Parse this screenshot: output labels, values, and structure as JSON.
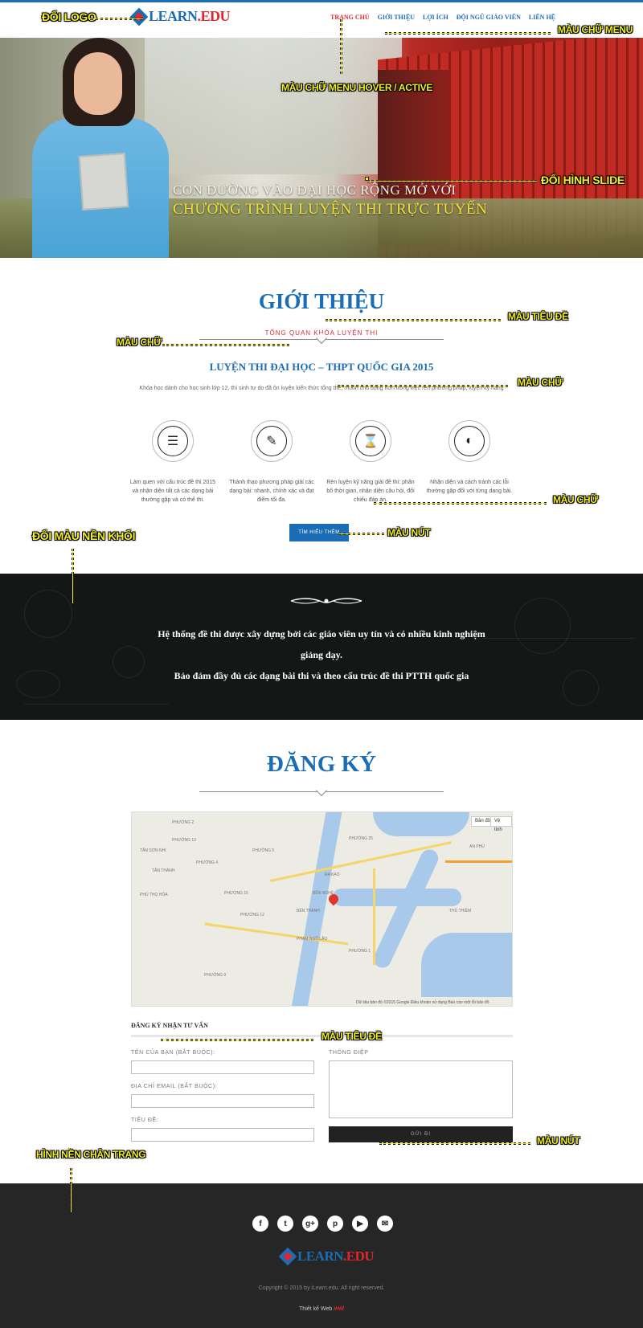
{
  "header": {
    "logo_main": "LEARN",
    "logo_ext": ".EDU",
    "menu": [
      {
        "label": "TRANG CHỦ",
        "active": true
      },
      {
        "label": "GIỚI THIỆU",
        "active": false
      },
      {
        "label": "LỢI ÍCH",
        "active": false
      },
      {
        "label": "ĐỘI NGŨ GIÁO VIÊN",
        "active": false
      },
      {
        "label": "LIÊN HỆ",
        "active": false
      }
    ]
  },
  "hero": {
    "line1": "CON ĐƯỜNG VÀO ĐẠI HỌC RỘNG MỞ VỚI",
    "line2": "CHƯƠNG TRÌNH LUYỆN THI TRỰC TUYẾN"
  },
  "intro": {
    "title": "GIỚI THIỆU",
    "subtitle": "TỔNG QUAN KHÓA LUYỆN THI",
    "course_title": "LUYỆN THI ĐẠI HỌC – THPT QUỐC GIA 2015",
    "course_desc": "Khóa học dành cho học sinh lớp 12, thí sinh tự do đã ôn luyện kiến thức tổng thể, muốn chủ động hơn trong việc rèn phương pháp, luyện kỹ năng",
    "features": [
      {
        "icon": "list-icon",
        "glyph": "☰",
        "text": "Làm quen với cấu trúc đề thi 2015 và nhận diện tất cả các dạng bài thường gặp và có thể thi."
      },
      {
        "icon": "pencil-icon",
        "glyph": "✎",
        "text": "Thành thạo phương pháp giải các dạng bài: nhanh, chính xác và đạt điểm tối đa."
      },
      {
        "icon": "hourglass-icon",
        "glyph": "⌛",
        "text": "Rèn luyện kỹ năng giải đề thi: phân bổ thời gian, nhận diện câu hỏi, đối chiếu đáp án."
      },
      {
        "icon": "brightness-icon",
        "glyph": "◐",
        "text": "Nhận diện và cách tránh các lỗi thường gặp đối với từng dạng bài."
      }
    ],
    "button": "TÌM HIỂU THÊM"
  },
  "band": {
    "line1": "Hệ thống đề thi được xây dựng bởi các giáo viên uy tín và có nhiều kinh nghiệm",
    "line2": "giảng dạy.",
    "line3": "Bảo đảm đầy đủ các dạng bài thi và theo cấu trúc đề thi PTTH quốc gia"
  },
  "register": {
    "title": "ĐĂNG KÝ",
    "map_btn_map": "Bản đồ",
    "map_btn_sat": "Vệ tinh",
    "map_footer": "Dữ liệu bản đồ ©2015 Google   Điều khoản sử dụng   Báo cáo một lỗi bản đồ",
    "map_labels": [
      "PHƯỜNG 2",
      "PHƯỜNG 13",
      "TÂN SƠN NHÌ",
      "TÂN THÀNH",
      "PHƯỜNG 4",
      "PHƯỜNG 25",
      "PHƯỜNG 5",
      "PHÚ THỌ HÒA",
      "PHƯỜNG 15",
      "ĐA KAO",
      "BẾN NGHÉ",
      "BẾN THÀNH",
      "PHẠM NGŨ LÃO",
      "PHƯỜNG 12",
      "AN PHÚ",
      "THỦ THIÊM",
      "PHƯỜNG 1",
      "PHƯỜNG 9"
    ],
    "form_heading": "ĐĂNG KÝ NHẬN TƯ VẤN",
    "label_name": "TÊN CỦA BẠN (BẮT BUỘC):",
    "label_email": "ĐỊA CHỈ EMAIL (BẮT BUỘC):",
    "label_subject": "TIÊU ĐỀ:",
    "label_message": "THÔNG ĐIỆP",
    "name_value": "",
    "email_value": "",
    "subject_value": "",
    "message_value": "",
    "send": "GỬI ĐI"
  },
  "footer": {
    "social": [
      {
        "icon": "facebook-icon",
        "glyph": "f"
      },
      {
        "icon": "twitter-icon",
        "glyph": "t"
      },
      {
        "icon": "google-plus-icon",
        "glyph": "g+"
      },
      {
        "icon": "pinterest-icon",
        "glyph": "p"
      },
      {
        "icon": "youtube-icon",
        "glyph": "▶"
      },
      {
        "icon": "email-icon",
        "glyph": "✉"
      }
    ],
    "logo_main": "LEARN",
    "logo_ext": ".EDU",
    "copyright": "Copyright © 2015 by iLearn.edu. All right reserved.",
    "designer_label": "Thiết kế Web",
    "designer_brand": "iHill"
  },
  "annotations": {
    "change_logo": "ĐỔI LOGO",
    "menu_color": "MÀU CHỮ MENU",
    "menu_hover": "MÀU CHỮ MENU HOVER / ACTIVE",
    "change_slide": "ĐỔI HÌNH SLIDE",
    "title_color": "MÀU TIÊU ĐỀ",
    "text_color_1": "MÀU CHỮ",
    "text_color_2": "MÀU CHỮ",
    "text_color_3": "MÀU CHỮ",
    "button_color_1": "MÀU NÚT",
    "block_bg": "ĐỔI MÀU NỀN KHỐI",
    "title_color_2": "MÀU TIÊU ĐỀ",
    "footer_bg": "HÌNH NỀN CHÂN TRANG",
    "button_color_2": "MÀU NÚT"
  },
  "colors": {
    "brand_blue": "#1b6db5",
    "brand_red": "#e3262e",
    "annotation_yellow": "#f2ef1c",
    "band_dark": "#131817",
    "footer_dark": "#262626"
  }
}
